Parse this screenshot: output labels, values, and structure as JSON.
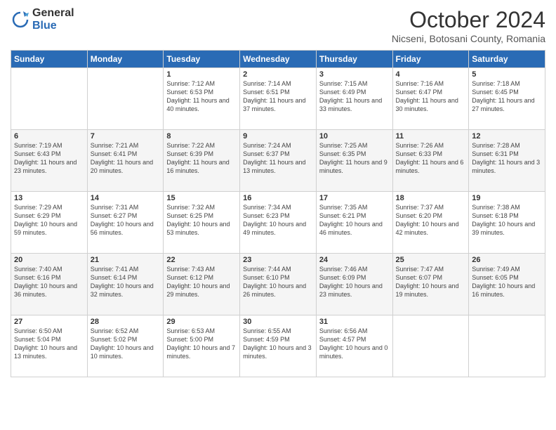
{
  "header": {
    "logo": {
      "general": "General",
      "blue": "Blue"
    },
    "month": "October 2024",
    "location": "Nicseni, Botosani County, Romania"
  },
  "weekdays": [
    "Sunday",
    "Monday",
    "Tuesday",
    "Wednesday",
    "Thursday",
    "Friday",
    "Saturday"
  ],
  "weeks": [
    [
      {
        "day": "",
        "sunrise": "",
        "sunset": "",
        "daylight": ""
      },
      {
        "day": "",
        "sunrise": "",
        "sunset": "",
        "daylight": ""
      },
      {
        "day": "1",
        "sunrise": "Sunrise: 7:12 AM",
        "sunset": "Sunset: 6:53 PM",
        "daylight": "Daylight: 11 hours and 40 minutes."
      },
      {
        "day": "2",
        "sunrise": "Sunrise: 7:14 AM",
        "sunset": "Sunset: 6:51 PM",
        "daylight": "Daylight: 11 hours and 37 minutes."
      },
      {
        "day": "3",
        "sunrise": "Sunrise: 7:15 AM",
        "sunset": "Sunset: 6:49 PM",
        "daylight": "Daylight: 11 hours and 33 minutes."
      },
      {
        "day": "4",
        "sunrise": "Sunrise: 7:16 AM",
        "sunset": "Sunset: 6:47 PM",
        "daylight": "Daylight: 11 hours and 30 minutes."
      },
      {
        "day": "5",
        "sunrise": "Sunrise: 7:18 AM",
        "sunset": "Sunset: 6:45 PM",
        "daylight": "Daylight: 11 hours and 27 minutes."
      }
    ],
    [
      {
        "day": "6",
        "sunrise": "Sunrise: 7:19 AM",
        "sunset": "Sunset: 6:43 PM",
        "daylight": "Daylight: 11 hours and 23 minutes."
      },
      {
        "day": "7",
        "sunrise": "Sunrise: 7:21 AM",
        "sunset": "Sunset: 6:41 PM",
        "daylight": "Daylight: 11 hours and 20 minutes."
      },
      {
        "day": "8",
        "sunrise": "Sunrise: 7:22 AM",
        "sunset": "Sunset: 6:39 PM",
        "daylight": "Daylight: 11 hours and 16 minutes."
      },
      {
        "day": "9",
        "sunrise": "Sunrise: 7:24 AM",
        "sunset": "Sunset: 6:37 PM",
        "daylight": "Daylight: 11 hours and 13 minutes."
      },
      {
        "day": "10",
        "sunrise": "Sunrise: 7:25 AM",
        "sunset": "Sunset: 6:35 PM",
        "daylight": "Daylight: 11 hours and 9 minutes."
      },
      {
        "day": "11",
        "sunrise": "Sunrise: 7:26 AM",
        "sunset": "Sunset: 6:33 PM",
        "daylight": "Daylight: 11 hours and 6 minutes."
      },
      {
        "day": "12",
        "sunrise": "Sunrise: 7:28 AM",
        "sunset": "Sunset: 6:31 PM",
        "daylight": "Daylight: 11 hours and 3 minutes."
      }
    ],
    [
      {
        "day": "13",
        "sunrise": "Sunrise: 7:29 AM",
        "sunset": "Sunset: 6:29 PM",
        "daylight": "Daylight: 10 hours and 59 minutes."
      },
      {
        "day": "14",
        "sunrise": "Sunrise: 7:31 AM",
        "sunset": "Sunset: 6:27 PM",
        "daylight": "Daylight: 10 hours and 56 minutes."
      },
      {
        "day": "15",
        "sunrise": "Sunrise: 7:32 AM",
        "sunset": "Sunset: 6:25 PM",
        "daylight": "Daylight: 10 hours and 53 minutes."
      },
      {
        "day": "16",
        "sunrise": "Sunrise: 7:34 AM",
        "sunset": "Sunset: 6:23 PM",
        "daylight": "Daylight: 10 hours and 49 minutes."
      },
      {
        "day": "17",
        "sunrise": "Sunrise: 7:35 AM",
        "sunset": "Sunset: 6:21 PM",
        "daylight": "Daylight: 10 hours and 46 minutes."
      },
      {
        "day": "18",
        "sunrise": "Sunrise: 7:37 AM",
        "sunset": "Sunset: 6:20 PM",
        "daylight": "Daylight: 10 hours and 42 minutes."
      },
      {
        "day": "19",
        "sunrise": "Sunrise: 7:38 AM",
        "sunset": "Sunset: 6:18 PM",
        "daylight": "Daylight: 10 hours and 39 minutes."
      }
    ],
    [
      {
        "day": "20",
        "sunrise": "Sunrise: 7:40 AM",
        "sunset": "Sunset: 6:16 PM",
        "daylight": "Daylight: 10 hours and 36 minutes."
      },
      {
        "day": "21",
        "sunrise": "Sunrise: 7:41 AM",
        "sunset": "Sunset: 6:14 PM",
        "daylight": "Daylight: 10 hours and 32 minutes."
      },
      {
        "day": "22",
        "sunrise": "Sunrise: 7:43 AM",
        "sunset": "Sunset: 6:12 PM",
        "daylight": "Daylight: 10 hours and 29 minutes."
      },
      {
        "day": "23",
        "sunrise": "Sunrise: 7:44 AM",
        "sunset": "Sunset: 6:10 PM",
        "daylight": "Daylight: 10 hours and 26 minutes."
      },
      {
        "day": "24",
        "sunrise": "Sunrise: 7:46 AM",
        "sunset": "Sunset: 6:09 PM",
        "daylight": "Daylight: 10 hours and 23 minutes."
      },
      {
        "day": "25",
        "sunrise": "Sunrise: 7:47 AM",
        "sunset": "Sunset: 6:07 PM",
        "daylight": "Daylight: 10 hours and 19 minutes."
      },
      {
        "day": "26",
        "sunrise": "Sunrise: 7:49 AM",
        "sunset": "Sunset: 6:05 PM",
        "daylight": "Daylight: 10 hours and 16 minutes."
      }
    ],
    [
      {
        "day": "27",
        "sunrise": "Sunrise: 6:50 AM",
        "sunset": "Sunset: 5:04 PM",
        "daylight": "Daylight: 10 hours and 13 minutes."
      },
      {
        "day": "28",
        "sunrise": "Sunrise: 6:52 AM",
        "sunset": "Sunset: 5:02 PM",
        "daylight": "Daylight: 10 hours and 10 minutes."
      },
      {
        "day": "29",
        "sunrise": "Sunrise: 6:53 AM",
        "sunset": "Sunset: 5:00 PM",
        "daylight": "Daylight: 10 hours and 7 minutes."
      },
      {
        "day": "30",
        "sunrise": "Sunrise: 6:55 AM",
        "sunset": "Sunset: 4:59 PM",
        "daylight": "Daylight: 10 hours and 3 minutes."
      },
      {
        "day": "31",
        "sunrise": "Sunrise: 6:56 AM",
        "sunset": "Sunset: 4:57 PM",
        "daylight": "Daylight: 10 hours and 0 minutes."
      },
      {
        "day": "",
        "sunrise": "",
        "sunset": "",
        "daylight": ""
      },
      {
        "day": "",
        "sunrise": "",
        "sunset": "",
        "daylight": ""
      }
    ]
  ]
}
